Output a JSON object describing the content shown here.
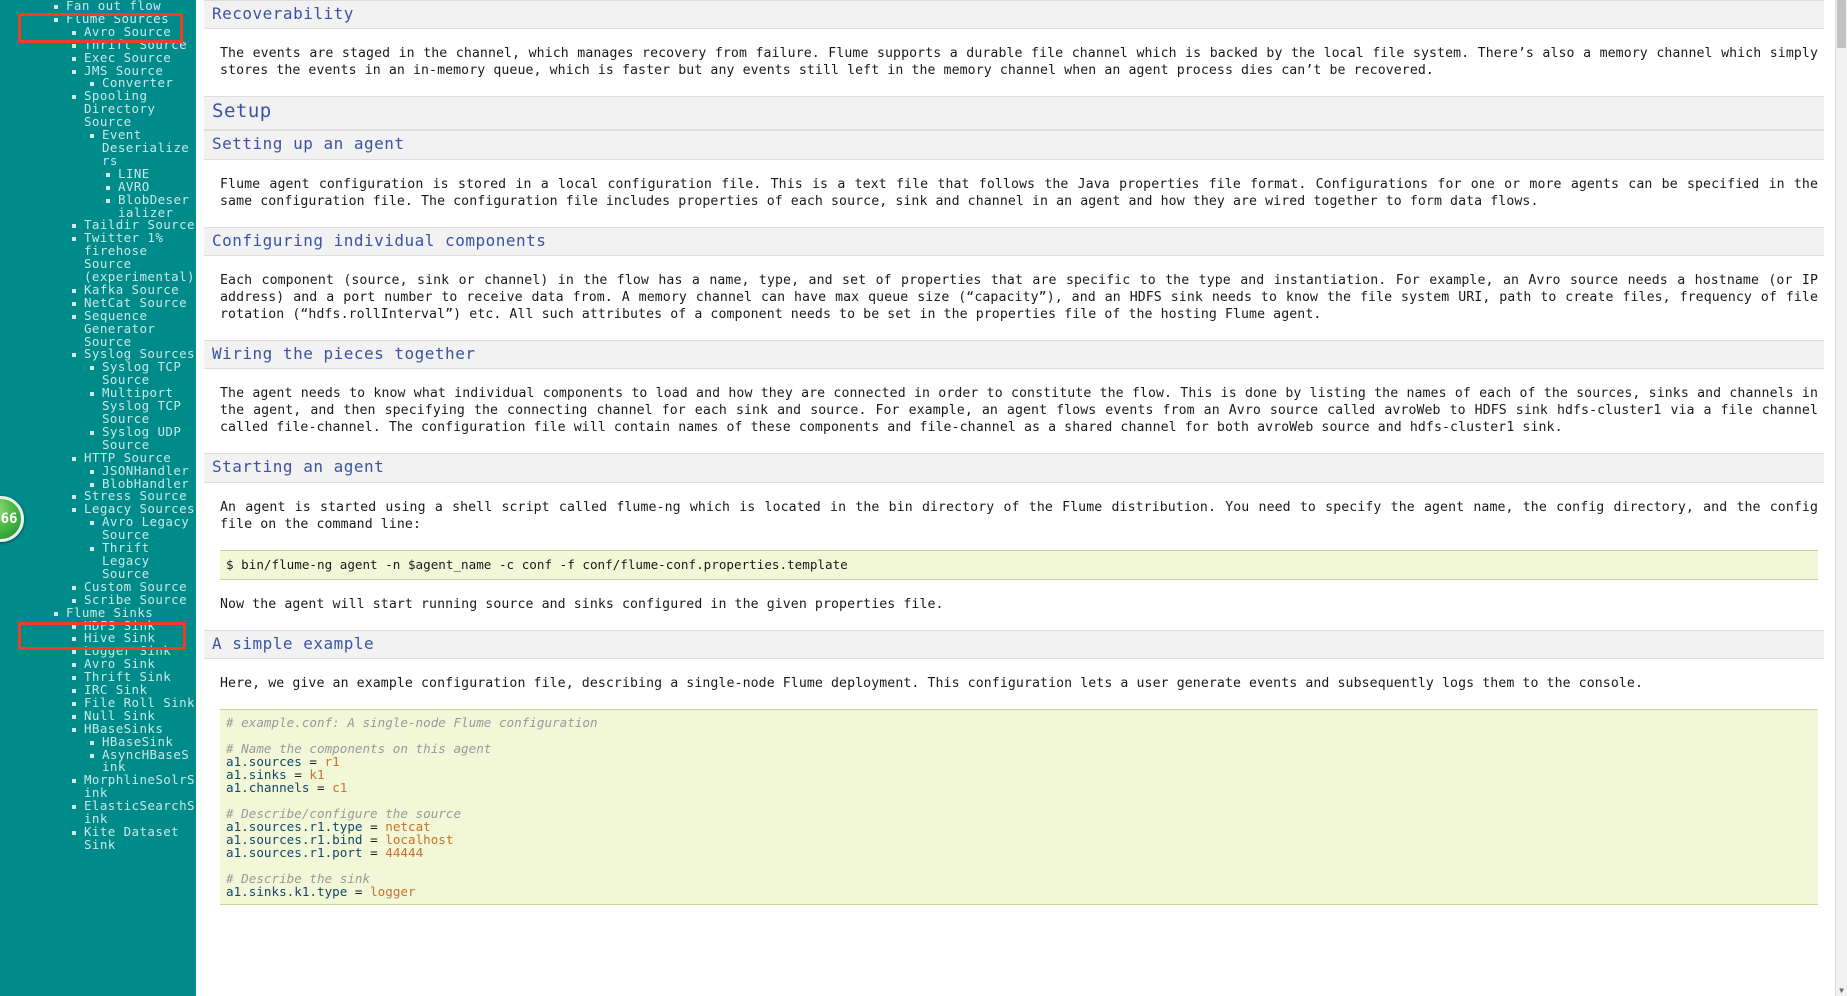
{
  "sidebar": {
    "items": [
      {
        "label": "Fan out flow",
        "level": 1
      },
      {
        "label": "Flume Sources",
        "level": 1,
        "highlighted": true
      },
      {
        "label": "Avro Source",
        "level": 2
      },
      {
        "label": "Thrift Source",
        "level": 2
      },
      {
        "label": "Exec Source",
        "level": 2
      },
      {
        "label": "JMS Source",
        "level": 2
      },
      {
        "label": "Converter",
        "level": 3
      },
      {
        "label": "Spooling Directory Source",
        "level": 2
      },
      {
        "label": "Event Deserializers",
        "level": 3
      },
      {
        "label": "LINE",
        "level": 4
      },
      {
        "label": "AVRO",
        "level": 4
      },
      {
        "label": "BlobDeserializer",
        "level": 4
      },
      {
        "label": "Taildir Source",
        "level": 2
      },
      {
        "label": "Twitter 1% firehose Source (experimental)",
        "level": 2
      },
      {
        "label": "Kafka Source",
        "level": 2
      },
      {
        "label": "NetCat Source",
        "level": 2
      },
      {
        "label": "Sequence Generator Source",
        "level": 2
      },
      {
        "label": "Syslog Sources",
        "level": 2
      },
      {
        "label": "Syslog TCP Source",
        "level": 3
      },
      {
        "label": "Multiport Syslog TCP Source",
        "level": 3
      },
      {
        "label": "Syslog UDP Source",
        "level": 3
      },
      {
        "label": "HTTP Source",
        "level": 2
      },
      {
        "label": "JSONHandler",
        "level": 3
      },
      {
        "label": "BlobHandler",
        "level": 3
      },
      {
        "label": "Stress Source",
        "level": 2
      },
      {
        "label": "Legacy Sources",
        "level": 2
      },
      {
        "label": "Avro Legacy Source",
        "level": 3
      },
      {
        "label": "Thrift Legacy Source",
        "level": 3
      },
      {
        "label": "Custom Source",
        "level": 2
      },
      {
        "label": "Scribe Source",
        "level": 2
      },
      {
        "label": "Flume Sinks",
        "level": 1,
        "highlighted": true
      },
      {
        "label": "HDFS Sink",
        "level": 2
      },
      {
        "label": "Hive Sink",
        "level": 2
      },
      {
        "label": "Logger Sink",
        "level": 2
      },
      {
        "label": "Avro Sink",
        "level": 2
      },
      {
        "label": "Thrift Sink",
        "level": 2
      },
      {
        "label": "IRC Sink",
        "level": 2
      },
      {
        "label": "File Roll Sink",
        "level": 2
      },
      {
        "label": "Null Sink",
        "level": 2
      },
      {
        "label": "HBaseSinks",
        "level": 2
      },
      {
        "label": "HBaseSink",
        "level": 3
      },
      {
        "label": "AsyncHBaseSink",
        "level": 3
      },
      {
        "label": "MorphlineSolrSink",
        "level": 2
      },
      {
        "label": "ElasticSearchSink",
        "level": 2
      },
      {
        "label": "Kite Dataset Sink",
        "level": 2
      }
    ],
    "badge_count": "66",
    "colors": {
      "background": "#008b8b",
      "text": "#c9e8e8",
      "highlight_box": "#f23c28",
      "badge": "#4fbb46"
    }
  },
  "content": {
    "sections": [
      {
        "id": "recoverability",
        "heading": "Recoverability",
        "heading_level": "h3",
        "paragraph": "The events are staged in the channel, which manages recovery from failure. Flume supports a durable file channel which is backed by the local file system. There’s also a memory channel which simply stores the events in an in-memory queue, which is faster but any events still left in the memory channel when an agent process dies can’t be recovered."
      },
      {
        "id": "setup",
        "heading": "Setup",
        "heading_level": "h2"
      },
      {
        "id": "setting-up-an-agent",
        "heading": "Setting up an agent",
        "heading_level": "h3",
        "paragraph": "Flume agent configuration is stored in a local configuration file. This is a text file that follows the Java properties file format. Configurations for one or more agents can be specified in the same configuration file. The configuration file includes properties of each source, sink and channel in an agent and how they are wired together to form data flows."
      },
      {
        "id": "configuring-individual-components",
        "heading": "Configuring individual components",
        "heading_level": "h3",
        "paragraph": "Each component (source, sink or channel) in the flow has a name, type, and set of properties that are specific to the type and instantiation. For example, an Avro source needs a hostname (or IP address) and a port number to receive data from. A memory channel can have max queue size (“capacity”), and an HDFS sink needs to know the file system URI, path to create files, frequency of file rotation (“hdfs.rollInterval”) etc. All such attributes of a component needs to be set in the properties file of the hosting Flume agent."
      },
      {
        "id": "wiring-the-pieces-together",
        "heading": "Wiring the pieces together",
        "heading_level": "h3",
        "paragraph": "The agent needs to know what individual components to load and how they are connected in order to constitute the flow. This is done by listing the names of each of the sources, sinks and channels in the agent, and then specifying the connecting channel for each sink and source. For example, an agent flows events from an Avro source called avroWeb to HDFS sink hdfs-cluster1 via a file channel called file-channel. The configuration file will contain names of these components and file-channel as a shared channel for both avroWeb source and hdfs-cluster1 sink."
      },
      {
        "id": "starting-an-agent",
        "heading": "Starting an agent",
        "heading_level": "h3",
        "paragraph": "An agent is started using a shell script called flume-ng which is located in the bin directory of the Flume distribution. You need to specify the agent name, the config directory, and the config file on the command line:",
        "code_command": "$ bin/flume-ng agent -n $agent_name -c conf -f conf/flume-conf.properties.template",
        "paragraph_after": "Now the agent will start running source and sinks configured in the given properties file."
      },
      {
        "id": "a-simple-example",
        "heading": "A simple example",
        "heading_level": "h3",
        "paragraph": "Here, we give an example configuration file, describing a single-node Flume deployment. This configuration lets a user generate events and subsequently logs them to the console.",
        "config_lines": [
          {
            "type": "comment",
            "text": "# example.conf: A single-node Flume configuration"
          },
          {
            "type": "blank"
          },
          {
            "type": "comment",
            "text": "# Name the components on this agent"
          },
          {
            "type": "kv",
            "key": "a1.sources",
            "op": " = ",
            "value": "r1"
          },
          {
            "type": "kv",
            "key": "a1.sinks",
            "op": " = ",
            "value": "k1"
          },
          {
            "type": "kv",
            "key": "a1.channels",
            "op": " = ",
            "value": "c1"
          },
          {
            "type": "blank"
          },
          {
            "type": "comment",
            "text": "# Describe/configure the source"
          },
          {
            "type": "kv",
            "key": "a1.sources.r1.type",
            "op": " = ",
            "value": "netcat"
          },
          {
            "type": "kv",
            "key": "a1.sources.r1.bind",
            "op": " = ",
            "value": "localhost"
          },
          {
            "type": "kv",
            "key": "a1.sources.r1.port",
            "op": " = ",
            "value": "44444"
          },
          {
            "type": "blank"
          },
          {
            "type": "comment",
            "text": "# Describe the sink"
          },
          {
            "type": "kv",
            "key": "a1.sinks.k1.type",
            "op": " = ",
            "value": "logger"
          }
        ]
      }
    ],
    "colors": {
      "heading": "#3a53a4",
      "heading_band": "#f2f2f2",
      "code_background": "#f2f7d8",
      "code_key": "#12476b",
      "code_value": "#c8722a",
      "code_comment": "#9a9a9a"
    }
  },
  "scrollbar": {
    "up_arrow": "▲",
    "down_arrow": "▼"
  }
}
